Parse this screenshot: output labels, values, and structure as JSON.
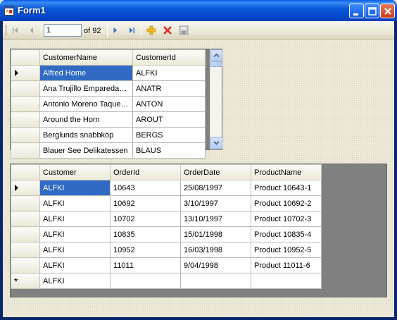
{
  "window": {
    "title": "Form1"
  },
  "navigator": {
    "position": "1",
    "count_label": "of 92"
  },
  "customers": {
    "columns": [
      "CustomerName",
      "CustomerId"
    ],
    "rows": [
      [
        "Alfred Home",
        "ALFKI"
      ],
      [
        "Ana Trujillo Emparedados y helados",
        "ANATR"
      ],
      [
        "Antonio Moreno Taquería",
        "ANTON"
      ],
      [
        "Around the Horn",
        "AROUT"
      ],
      [
        "Berglunds snabbköp",
        "BERGS"
      ],
      [
        "Blauer See Delikatessen",
        "BLAUS"
      ]
    ]
  },
  "orders": {
    "columns": [
      "Customer",
      "OrderId",
      "OrderDate",
      "ProductName"
    ],
    "rows": [
      [
        "ALFKI",
        "10643",
        "25/08/1997",
        "Product 10643-1"
      ],
      [
        "ALFKI",
        "10692",
        "3/10/1997",
        "Product 10692-2"
      ],
      [
        "ALFKI",
        "10702",
        "13/10/1997",
        "Product 10702-3"
      ],
      [
        "ALFKI",
        "10835",
        "15/01/1998",
        "Product 10835-4"
      ],
      [
        "ALFKI",
        "10952",
        "16/03/1998",
        "Product 10952-5"
      ],
      [
        "ALFKI",
        "11011",
        "9/04/1998",
        "Product 11011-6"
      ]
    ],
    "new_row": [
      "ALFKI",
      "",
      "",
      ""
    ],
    "new_row_marker": "*"
  },
  "icons": [
    "app-icon",
    "minimize-icon",
    "maximize-icon",
    "close-icon",
    "move-first-icon",
    "move-previous-icon",
    "move-next-icon",
    "move-last-icon",
    "add-new-icon",
    "delete-icon",
    "save-icon",
    "current-row-icon"
  ],
  "colors": {
    "selection": "#316ac5",
    "titlebar": "#0a58d8"
  }
}
